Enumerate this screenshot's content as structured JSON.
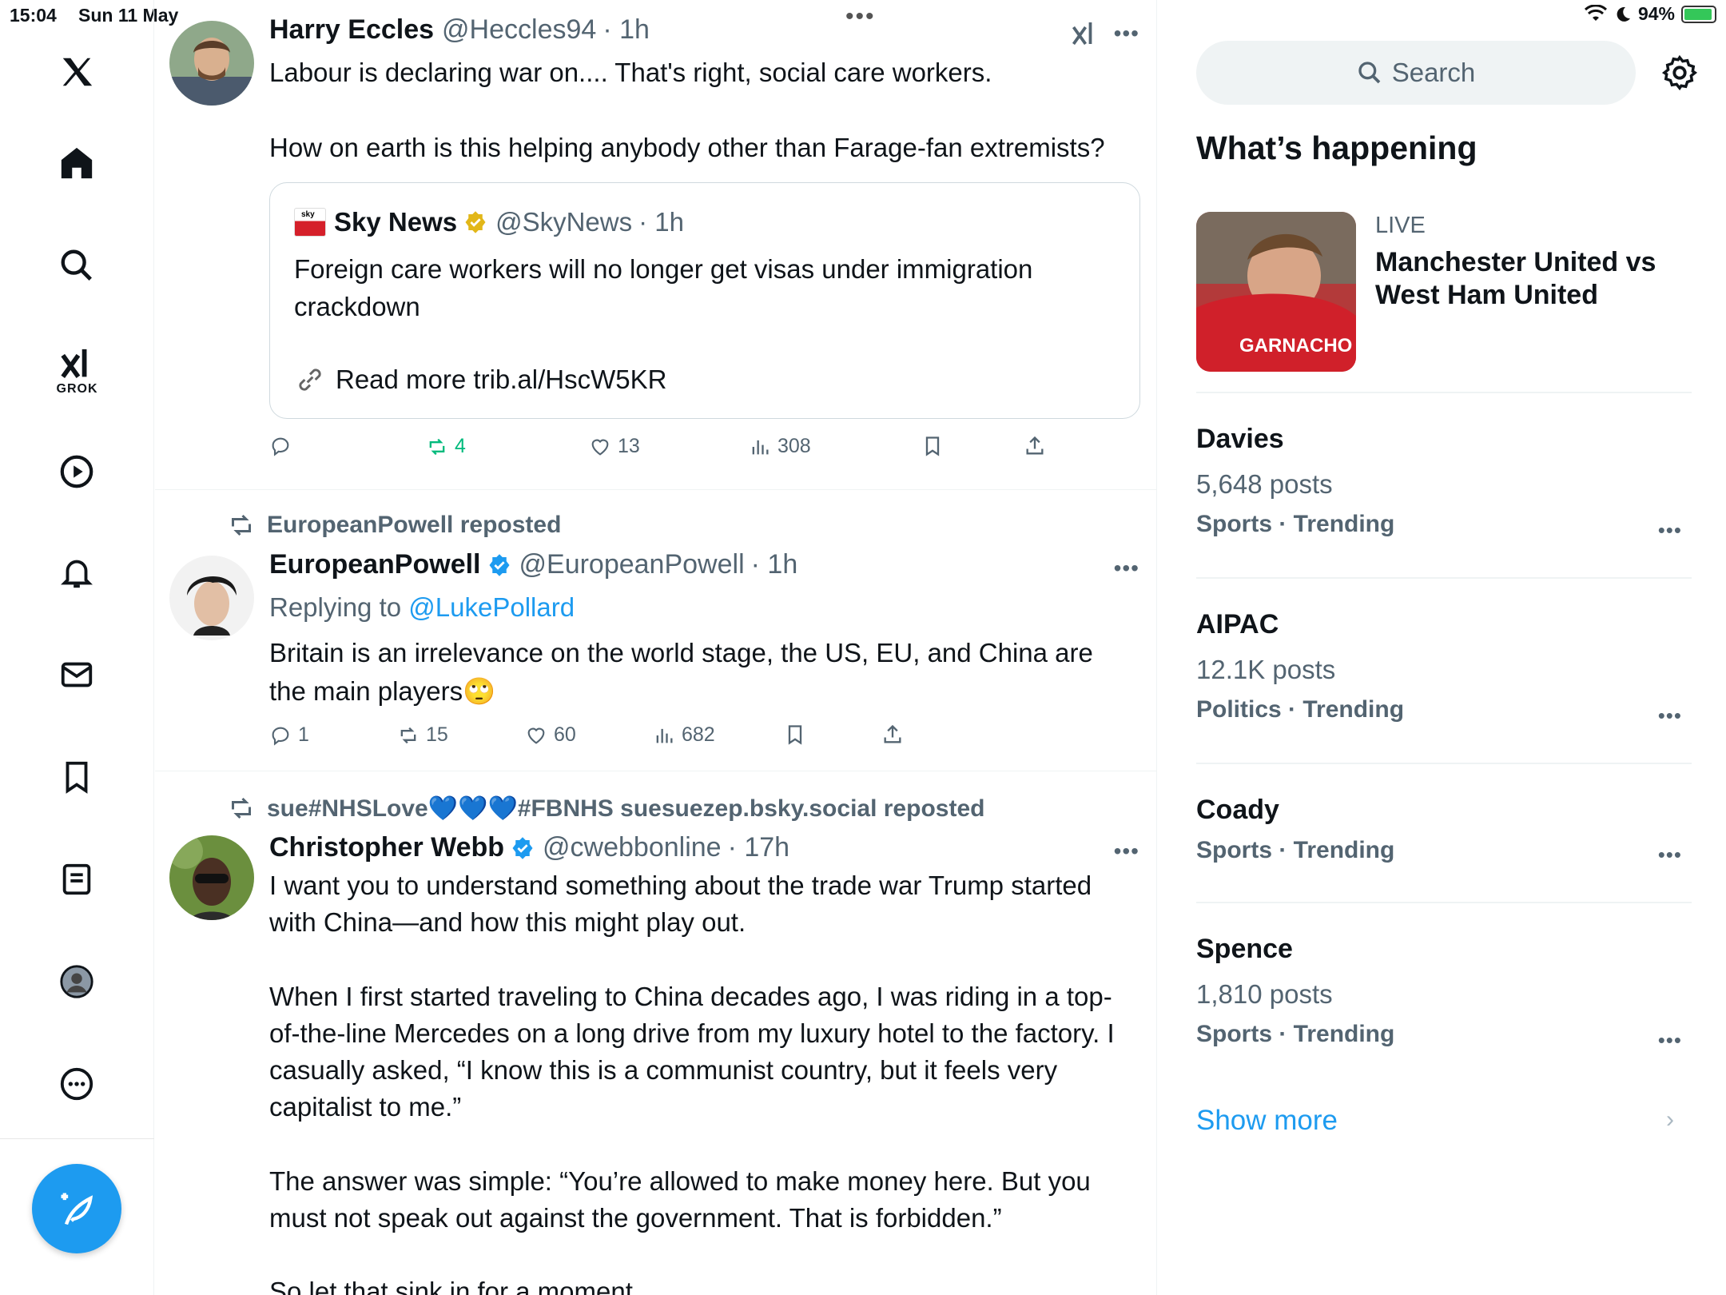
{
  "status_bar": {
    "time": "15:04",
    "date": "Sun 11 May",
    "battery": "94%"
  },
  "nav": {
    "grok_label": "GROK",
    "items": [
      "x-logo",
      "home-icon",
      "search-icon",
      "grok-icon",
      "video-icon",
      "notifications-icon",
      "messages-icon",
      "bookmarks-icon",
      "lists-icon",
      "profile-icon",
      "more-icon",
      "compose-post-button"
    ]
  },
  "posts": [
    {
      "name": "Harry Eccles",
      "handle": "@Heccles94",
      "time": "· 1h",
      "text1": "Labour is declaring war on.... That's right, social care workers.",
      "text2": "How on earth is this helping anybody other than Farage-fan extremists?",
      "quote": {
        "name": "Sky News",
        "handle": "@SkyNews",
        "time": "· 1h",
        "logo_text": "sky",
        "text": "Foreign care workers will no longer get visas under immigration crackdown",
        "link": "Read more trib.al/HscW5KR"
      },
      "stats": {
        "replies": "",
        "reposts": "4",
        "likes": "13",
        "views": "308"
      }
    },
    {
      "repost_by": "EuropeanPowell reposted",
      "name": "EuropeanPowell",
      "handle": "@EuropeanPowell",
      "time": "· 1h",
      "replying_prefix": "Replying to ",
      "replying_to": "@LukePollard",
      "text": "Britain is an irrelevance on the world stage, the US, EU, and China are the main players",
      "emoji": "🙄",
      "stats": {
        "replies": "1",
        "reposts": "15",
        "likes": "60",
        "views": "682"
      }
    },
    {
      "repost_by": "sue#NHSLove💙💙💙#FBNHS suesuezep.bsky.social reposted",
      "name": "Christopher Webb",
      "handle": "@cwebbonline",
      "time": "· 17h",
      "text1": "I want you to understand something about the trade war Trump started with China—and how this might play out.",
      "text2": "When I first started traveling to China decades ago, I was riding in a top-of-the-line Mercedes on a long drive from my luxury hotel to the factory. I casually asked, “I know this is a communist country, but it feels very capitalist to me.”",
      "text3": "The answer was simple: “You’re allowed to make money here. But you must not speak out against the government. That is forbidden.”",
      "text4": "So let that sink in for a moment."
    }
  ],
  "sidebar": {
    "search_placeholder": "Search",
    "whats_happening": "What’s happening",
    "live": {
      "label": "LIVE",
      "title": "Manchester United vs West Ham United",
      "shirt_text": "GARNACHO"
    },
    "trends": [
      {
        "name": "Davies",
        "count": "5,648 posts",
        "meta": "Sports · Trending"
      },
      {
        "name": "AIPAC",
        "count": "12.1K posts",
        "meta": "Politics · Trending"
      },
      {
        "name": "Coady",
        "count": "",
        "meta": "Sports · Trending"
      },
      {
        "name": "Spence",
        "count": "1,810 posts",
        "meta": "Sports · Trending"
      }
    ],
    "show_more": "Show more"
  },
  "colors": {
    "accent": "#1d9bf0",
    "repost_green": "#00ba7c",
    "muted": "#536471"
  }
}
